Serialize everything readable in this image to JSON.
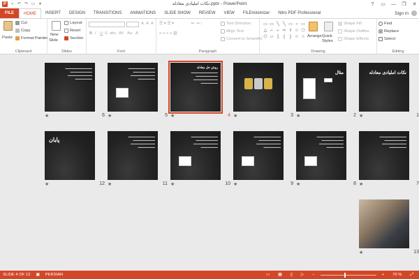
{
  "window": {
    "title": "نکات املیادی معادله.pptx - PowerPoint",
    "app_icon": "P",
    "qat_icons": [
      "save-icon",
      "undo-icon",
      "redo-icon",
      "start-slideshow-icon",
      "customize-qat-icon"
    ],
    "help": "?",
    "minimize": "—",
    "restore": "❐",
    "close": "✕"
  },
  "tabs": [
    "FILE",
    "HOME",
    "INSERT",
    "DESIGN",
    "TRANSITIONS",
    "ANIMATIONS",
    "SLIDE SHOW",
    "REVIEW",
    "VIEW",
    "FILEminimizer",
    "Nitro PDF Professional"
  ],
  "active_tab": "HOME",
  "signin": "Sign in",
  "ribbon": {
    "clipboard": {
      "label": "Clipboard",
      "paste": "Paste",
      "cut": "Cut",
      "copy": "Copy",
      "format_painter": "Format Painter"
    },
    "slides": {
      "label": "Slides",
      "new_slide": "New",
      "new_slide2": "Slide",
      "layout": "Layout",
      "reset": "Reset",
      "section": "Section"
    },
    "font": {
      "label": "Font",
      "bold": "B",
      "italic": "I",
      "underline": "U",
      "strike": "S",
      "shadow": "abc",
      "spacing": "AV",
      "case": "Aa",
      "color": "A",
      "grow": "A",
      "shrink": "A",
      "clear": "A"
    },
    "paragraph": {
      "label": "Paragraph",
      "text_direction": "Text Direction",
      "align_text": "Align Text",
      "convert_smartart": "Convert to SmartArt"
    },
    "drawing": {
      "label": "Drawing",
      "arrange": "Arrange",
      "quick_styles": "Quick Styles",
      "shape_fill": "Shape Fill",
      "shape_outline": "Shape Outline",
      "shape_effects": "Shape Effects",
      "shapes": [
        "▭",
        "▭",
        "╲",
        "╲",
        "▭",
        "○",
        "▭",
        "△",
        "⌐",
        "⌐",
        "⇨",
        "⇩",
        "☆",
        "⬠",
        "⬡",
        "▱",
        "⟆",
        "{",
        "}",
        "☆",
        "☆",
        "◯",
        "⌒",
        "⌒",
        "▭",
        "▭",
        "⬚",
        "▷"
      ]
    },
    "editing": {
      "label": "Editing",
      "find": "Find",
      "replace": "Replace",
      "select": "Select"
    }
  },
  "slides": [
    {
      "n": "1",
      "title": "نکات املیادی معادله",
      "kind": "title"
    },
    {
      "n": "2",
      "title": "مثال",
      "kind": "boxes"
    },
    {
      "n": "3",
      "title": "",
      "kind": "figures"
    },
    {
      "n": "4",
      "title": "روش حل معادله",
      "kind": "text",
      "selected": true
    },
    {
      "n": "5",
      "title": "",
      "kind": "textbox"
    },
    {
      "n": "6",
      "title": "",
      "kind": "text"
    },
    {
      "n": "7",
      "title": "",
      "kind": "text"
    },
    {
      "n": "8",
      "title": "",
      "kind": "textbox"
    },
    {
      "n": "9",
      "title": "",
      "kind": "textbox"
    },
    {
      "n": "10",
      "title": "",
      "kind": "textbox"
    },
    {
      "n": "11",
      "title": "",
      "kind": "text"
    },
    {
      "n": "12",
      "title": "پایان",
      "kind": "end"
    },
    {
      "n": "13",
      "title": "",
      "kind": "photo"
    }
  ],
  "transition_star": "★",
  "status": {
    "slide_of": "SLIDE 4 OF 13",
    "language": "PERSIAN",
    "zoom": "70 %",
    "zoom_out": "−",
    "zoom_in": "+",
    "fit": "⤢"
  },
  "colors": {
    "accent": "#d24726",
    "sorter_bg": "#eaeaea",
    "slide_bg": "#2a2a2a"
  }
}
